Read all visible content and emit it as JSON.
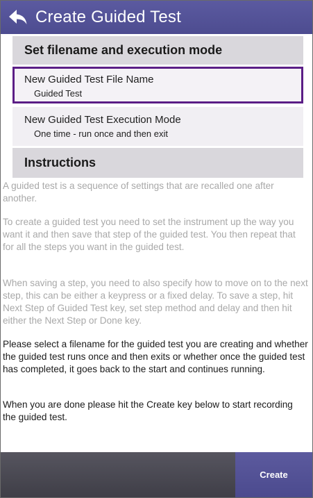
{
  "header": {
    "back_icon": "back-arrow-icon",
    "title": "Create Guided Test"
  },
  "sections": {
    "filename_mode": "Set filename and execution mode",
    "instructions": "Instructions"
  },
  "fields": {
    "file_name": {
      "label": "New Guided Test File Name",
      "value": "Guided Test"
    },
    "execution_mode": {
      "label": "New Guided Test Execution Mode",
      "value": "One time - run once and then exit"
    }
  },
  "instructions": {
    "p1": "A guided test is a sequence of settings that are recalled one after another.",
    "p2": "To create a guided test you need to set the instrument up the way you want it and then save that step of the guided test. You then repeat that for all the steps you want in the guided test.",
    "p3": "When saving a step, you need to also specify how to move on to the next step, this can be either a keypress or a fixed delay. To save a step, hit Next Step of Guided Test key, set step method and delay and then hit either the Next Step or Done key.",
    "p4": "Please select a filename for the guided test you are creating and whether the guided test runs once and then exits or whether once the guided test has completed, it goes back to the start and continues running.",
    "p5": "When you are done please hit the Create key below to start recording the guided test."
  },
  "footer": {
    "create_label": "Create"
  },
  "colors": {
    "titlebar": "#5b5aa0",
    "selected_border": "#5b1e86",
    "section_header": "#d9d7dc",
    "bottombar": "#4a4953"
  }
}
